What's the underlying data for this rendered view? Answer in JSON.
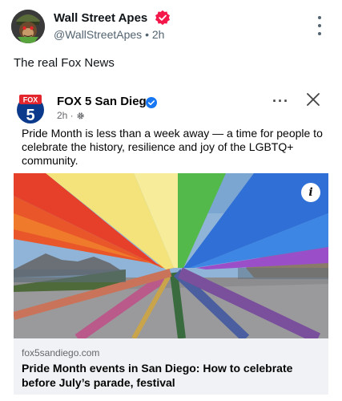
{
  "post": {
    "author_name": "Wall Street Apes",
    "handle": "@WallStreetApes",
    "separator": "•",
    "time": "2h",
    "text": "The real Fox News",
    "icons": {
      "verified": "verified-badge-icon",
      "more": "more-vertical-icon"
    },
    "colors": {
      "verified_badge": "#f4184a"
    }
  },
  "card": {
    "logo_text": "FOX",
    "logo_number": "5",
    "author": "FOX 5 San Diego",
    "time": "2h ·",
    "text": "Pride Month is less than a week away — a time for people to celebrate the history, resilience and joy of the LGBTQ+ community.",
    "info_label": "i",
    "link_domain": "fox5sandiego.com",
    "link_title": "Pride Month events in San Diego: How to celebrate before July’s parade, festival",
    "icons": {
      "verified": "verified-check-icon",
      "audience": "gear-icon",
      "more": "more-horizontal-icon",
      "close": "close-icon"
    },
    "colors": {
      "brand_blue": "#1877f2",
      "fox_red": "#e3262e",
      "fox_blue": "#0b3a8c",
      "link_bg": "#f0f2f5"
    }
  }
}
